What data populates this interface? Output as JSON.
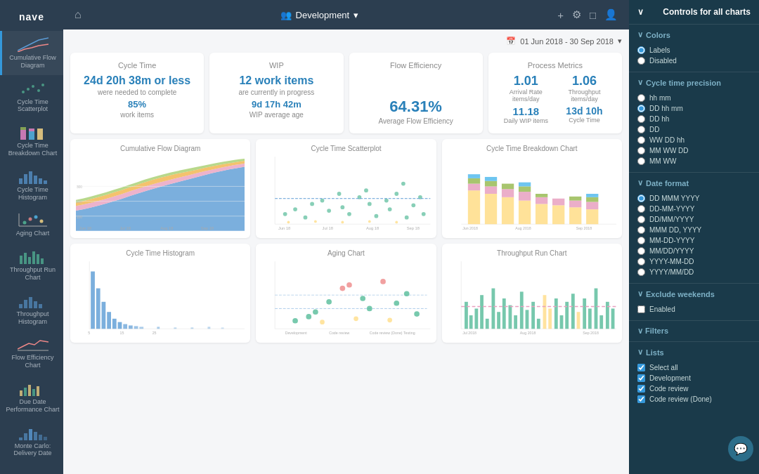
{
  "app": {
    "name": "nave",
    "workspace": "Development"
  },
  "date_range": "01 Jun 2018 - 30 Sep 2018",
  "metrics": {
    "cycle_time": {
      "title": "Cycle Time",
      "main_value": "24d 20h 38m or less",
      "main_sub": "were needed to complete",
      "secondary_value": "85%",
      "secondary_sub": "work items"
    },
    "wip": {
      "title": "WIP",
      "main_value": "12 work items",
      "main_sub": "are currently in progress",
      "secondary_value": "9d 17h 42m",
      "secondary_sub": "WIP average age"
    },
    "flow_efficiency": {
      "title": "Flow Efficiency",
      "main_value": "64.31%",
      "main_sub": "Average Flow Efficiency"
    },
    "process_metrics": {
      "title": "Process Metrics",
      "arrival_rate": "1.01",
      "arrival_label": "Arrival Rate items/day",
      "throughput": "1.06",
      "throughput_label": "Throughput items/day",
      "wip_items": "11.18",
      "wip_label": "Daily WIP items",
      "cycle_time": "13d 10h",
      "cycle_label": "Cycle Time"
    }
  },
  "charts": {
    "cfd": {
      "title": "Cumulative Flow Diagram"
    },
    "scatter": {
      "title": "Cycle Time Scatterplot"
    },
    "breakdown": {
      "title": "Cycle Time Breakdown Chart"
    },
    "histogram": {
      "title": "Cycle Time Histogram"
    },
    "aging": {
      "title": "Aging Chart"
    },
    "throughput": {
      "title": "Throughput Run Chart"
    }
  },
  "sidebar": {
    "items": [
      {
        "label": "Cumulative Flow Diagram",
        "id": "cfd"
      },
      {
        "label": "Cycle Time Scatterplot",
        "id": "scatter"
      },
      {
        "label": "Cycle Time Breakdown Chart",
        "id": "breakdown"
      },
      {
        "label": "Cycle Time Histogram",
        "id": "histogram"
      },
      {
        "label": "Aging Chart",
        "id": "aging"
      },
      {
        "label": "Throughput Run Chart",
        "id": "throughput-run"
      },
      {
        "label": "Throughput Histogram",
        "id": "throughput-hist"
      },
      {
        "label": "Flow Efficiency Chart",
        "id": "flow-eff"
      },
      {
        "label": "Due Date Performance Chart",
        "id": "due-date"
      },
      {
        "label": "Monte Carlo: Delivery Date",
        "id": "monte-carlo"
      }
    ]
  },
  "controls": {
    "panel_title": "Controls for all charts",
    "colors_title": "Colors",
    "colors_options": [
      "Labels",
      "Disabled"
    ],
    "colors_selected": "Labels",
    "cycle_time_precision_title": "Cycle time precision",
    "precision_options": [
      "hh mm",
      "DD hh mm",
      "DD hh",
      "DD",
      "WW DD hh",
      "MM WW DD",
      "MM WW"
    ],
    "precision_selected": "DD hh mm",
    "date_format_title": "Date format",
    "date_format_options": [
      "DD MMM YYYY",
      "DD-MM-YYYY",
      "DD/MM/YYYY",
      "MMM DD, YYYY",
      "MM-DD-YYYY",
      "MM/DD/YYYY",
      "YYYY-MM-DD",
      "YYYY/MM/DD"
    ],
    "date_format_selected": "DD MMM YYYY",
    "exclude_weekends_title": "Exclude weekends",
    "exclude_enabled": false,
    "filters_title": "Filters",
    "lists_title": "Lists",
    "lists": [
      {
        "label": "Select all",
        "checked": true
      },
      {
        "label": "Development",
        "checked": true
      },
      {
        "label": "Code review",
        "checked": true
      },
      {
        "label": "Code review (Done)",
        "checked": true
      }
    ]
  }
}
